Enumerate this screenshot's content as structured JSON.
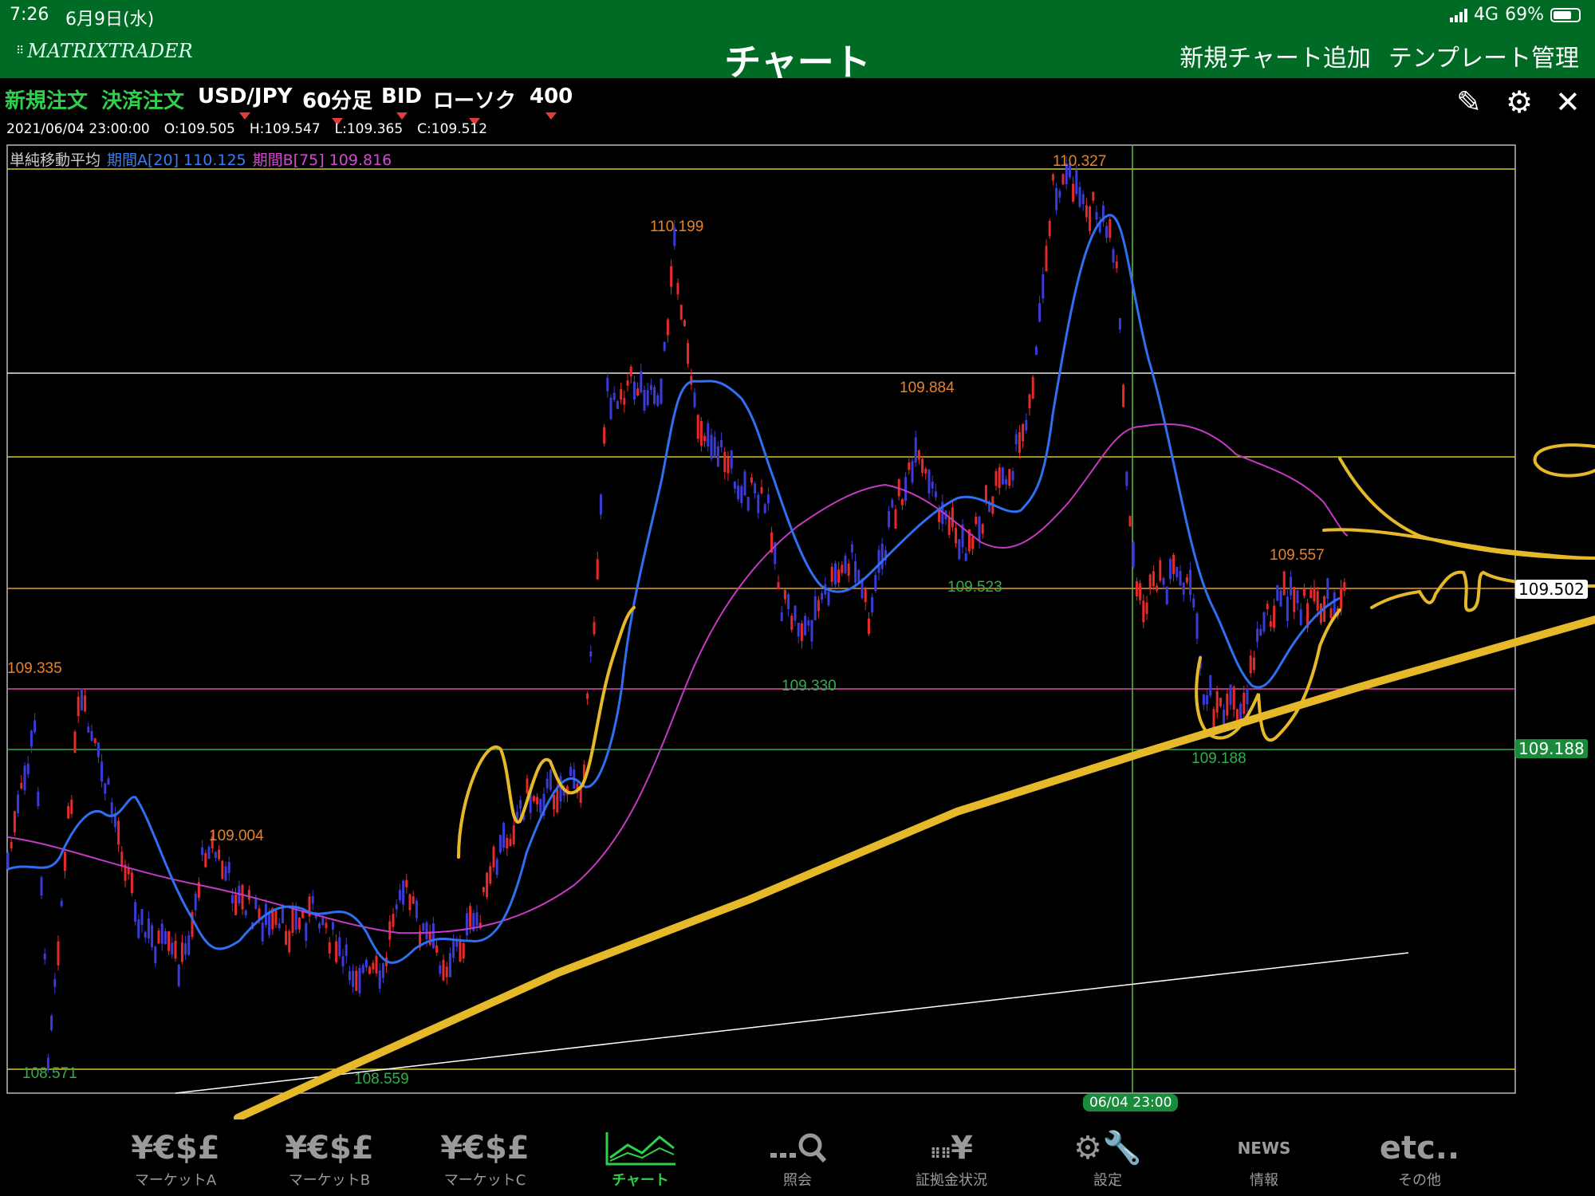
{
  "status": {
    "time": "7:26",
    "date": "6月9日(水)",
    "network": "4G",
    "battery": "69%"
  },
  "nav": {
    "logo": "MATRIXTRADER",
    "title": "チャート",
    "add_chart": "新規チャート追加",
    "template": "テンプレート管理"
  },
  "toolbar": {
    "new_order": "新規注文",
    "settle_order": "決済注文",
    "pair": "USD/JPY",
    "timeframe": "60分足",
    "price_type": "BID",
    "chart_type": "ローソク",
    "count": "400"
  },
  "ohlc": {
    "datetime": "2021/06/04 23:00:00",
    "open": "O:109.505",
    "high": "H:109.547",
    "low": "L:109.365",
    "close": "C:109.512"
  },
  "indicator": {
    "name": "単純移動平均",
    "a": "期間A[20] 110.125",
    "b": "期間B[75] 109.816"
  },
  "price_tags": {
    "current": "109.502",
    "line": "109.188",
    "time": "06/04 23:00"
  },
  "annotations": {
    "h1": "110.327",
    "h2": "110.199",
    "h3": "109.884",
    "h4": "109.557",
    "h5": "109.335",
    "h6": "109.004",
    "l1": "109.523",
    "l2": "109.330",
    "l3": "109.188",
    "l4": "108.571",
    "l5": "108.559"
  },
  "colors": {
    "header_green": "#006b25",
    "up": "#e82a2a",
    "down": "#3b3bd9",
    "ma_a": "#2f6ff0",
    "ma_b": "#c43ac4",
    "drawing": "#e6b92b"
  },
  "tabs": [
    {
      "icon": "¥€$£",
      "label": "マーケットA"
    },
    {
      "icon": "¥€$£",
      "label": "マーケットB"
    },
    {
      "icon": "¥€$£",
      "label": "マーケットC"
    },
    {
      "icon": "chart-line-icon",
      "label": "チャート"
    },
    {
      "icon": "search-icon",
      "label": "照会"
    },
    {
      "icon": "¥",
      "label": "証拠金状況"
    },
    {
      "icon": "gear-wrench-icon",
      "label": "設定"
    },
    {
      "icon": "NEWS",
      "label": "情報"
    },
    {
      "icon": "etc..",
      "label": "その他"
    }
  ],
  "chart_data": {
    "type": "candlestick",
    "pair": "USD/JPY",
    "timeframe": "60分足",
    "current_price": 109.502,
    "y_range": [
      108.5,
      110.35
    ],
    "horizontal_lines": [
      110.327,
      109.9,
      109.736,
      109.502,
      109.303,
      109.188,
      108.563
    ],
    "marked_highs": [
      110.327,
      110.199,
      109.884,
      109.557,
      109.335,
      109.004
    ],
    "marked_lows": [
      109.523,
      109.33,
      109.188,
      108.571,
      108.559
    ],
    "moving_averages": [
      {
        "name": "期間A[20]",
        "value": 110.125
      },
      {
        "name": "期間B[75]",
        "value": 109.816
      }
    ]
  }
}
